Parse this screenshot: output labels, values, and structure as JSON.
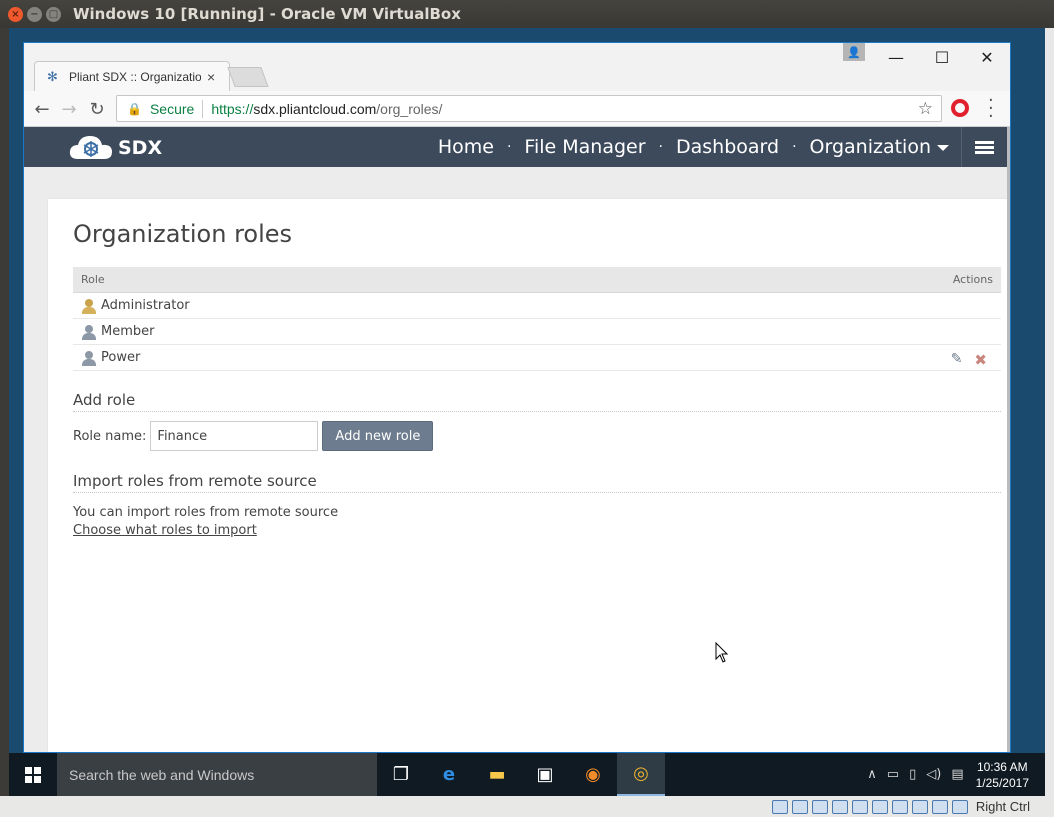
{
  "vbox": {
    "title": "Windows 10 [Running] - Oracle VM VirtualBox",
    "host_key": "Right Ctrl",
    "close": "×",
    "minimize": "−",
    "maximize": "□"
  },
  "chrome": {
    "tab_title": "Pliant SDX :: Organization",
    "tab_close": "×",
    "secure_label": "Secure",
    "url_scheme": "https://",
    "url_host": "sdx.pliantcloud.com",
    "url_path": "/org_roles/",
    "win_min": "—",
    "win_max": "☐",
    "win_close": "✕"
  },
  "site": {
    "brand": "SDX",
    "nav": [
      "Home",
      "File Manager",
      "Dashboard",
      "Organization"
    ],
    "nav_sep": "·"
  },
  "page": {
    "title": "Organization roles",
    "table": {
      "col_role": "Role",
      "col_actions": "Actions",
      "rows": [
        {
          "name": "Administrator",
          "icon": "admin-role-icon",
          "has_actions": false
        },
        {
          "name": "Member",
          "icon": "user-role-icon",
          "has_actions": false
        },
        {
          "name": "Power",
          "icon": "user-role-icon",
          "has_actions": true
        }
      ]
    },
    "add_role": {
      "title": "Add role",
      "label": "Role name:",
      "value": "Finance",
      "button": "Add new role"
    },
    "import": {
      "title": "Import roles from remote source",
      "text": "You can import roles from remote source",
      "link": "Choose what roles to import"
    }
  },
  "taskbar": {
    "search_placeholder": "Search the web and Windows",
    "time": "10:36 AM",
    "date": "1/25/2017"
  }
}
